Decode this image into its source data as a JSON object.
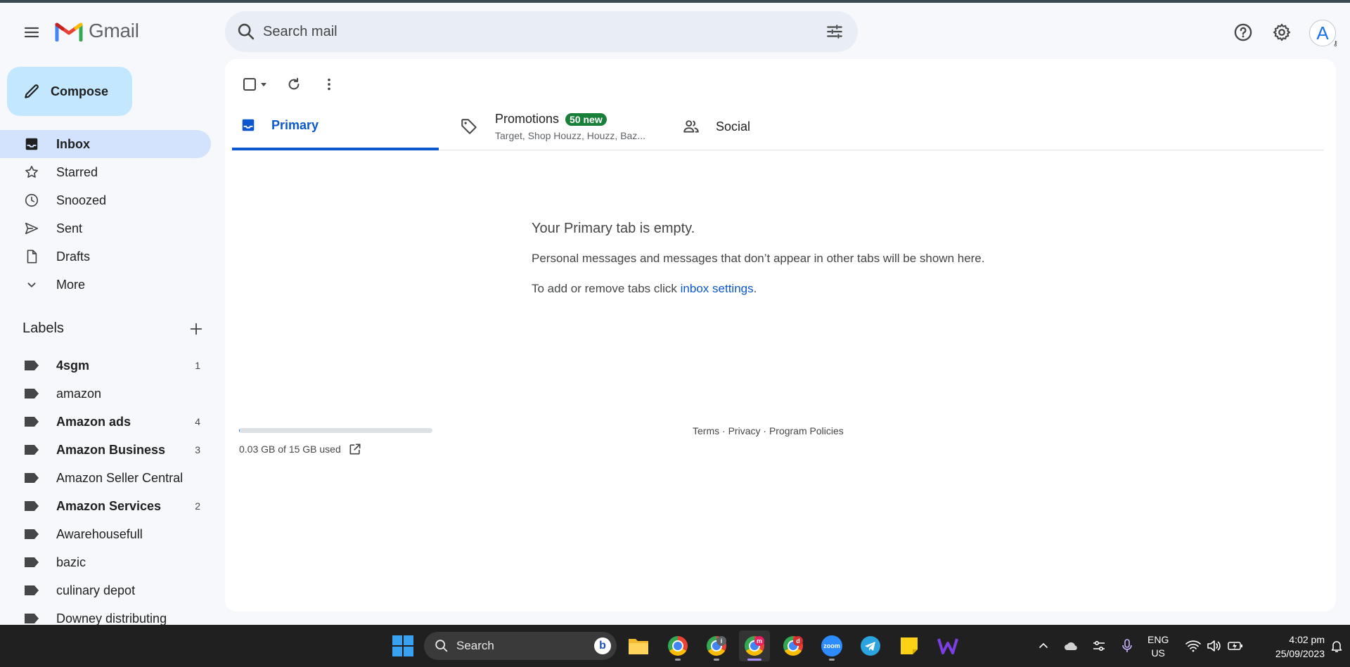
{
  "header": {
    "app_name": "Gmail",
    "search_placeholder": "Search mail",
    "avatar_initial": "A"
  },
  "sidebar": {
    "compose_label": "Compose",
    "nav": [
      {
        "label": "Inbox",
        "icon": "inbox-icon",
        "active": true
      },
      {
        "label": "Starred",
        "icon": "star-icon"
      },
      {
        "label": "Snoozed",
        "icon": "clock-icon"
      },
      {
        "label": "Sent",
        "icon": "send-icon"
      },
      {
        "label": "Drafts",
        "icon": "draft-icon"
      },
      {
        "label": "More",
        "icon": "chevron-down-icon"
      }
    ],
    "labels_title": "Labels",
    "labels": [
      {
        "label": "4sgm",
        "count": "1",
        "bold": true
      },
      {
        "label": "amazon",
        "count": ""
      },
      {
        "label": "Amazon ads",
        "count": "4",
        "bold": true
      },
      {
        "label": "Amazon Business",
        "count": "3",
        "bold": true
      },
      {
        "label": "Amazon Seller Central",
        "count": ""
      },
      {
        "label": "Amazon Services",
        "count": "2",
        "bold": true
      },
      {
        "label": "Awarehousefull",
        "count": ""
      },
      {
        "label": "bazic",
        "count": ""
      },
      {
        "label": "culinary depot",
        "count": ""
      },
      {
        "label": "Downey distributing",
        "count": ""
      }
    ]
  },
  "tabs": {
    "primary": "Primary",
    "promotions": "Promotions",
    "promotions_badge": "50 new",
    "promotions_snippet": "Target, Shop Houzz, Houzz, Baz...",
    "social": "Social"
  },
  "empty_state": {
    "title": "Your Primary tab is empty.",
    "description": "Personal messages and messages that don’t appear in other tabs will be shown here.",
    "hint_prefix": "To add or remove tabs click ",
    "hint_link": "inbox settings",
    "hint_suffix": "."
  },
  "footer": {
    "storage_text": "0.03 GB of 15 GB used",
    "storage_fraction": 0.002,
    "terms": "Terms",
    "privacy": "Privacy",
    "program_policies": "Program Policies",
    "separator": " · "
  },
  "taskbar": {
    "search_label": "Search",
    "chrome_badges": [
      "",
      "i",
      "m",
      "d"
    ],
    "zoom_label": "zoom",
    "language": "ENG",
    "region": "US",
    "time": "4:02 pm",
    "date": "25/09/2023"
  },
  "colors": {
    "accent": "#0b57d0",
    "compose_bg": "#c2e7ff",
    "active_nav": "#d3e3fd",
    "badge_green": "#188038"
  }
}
